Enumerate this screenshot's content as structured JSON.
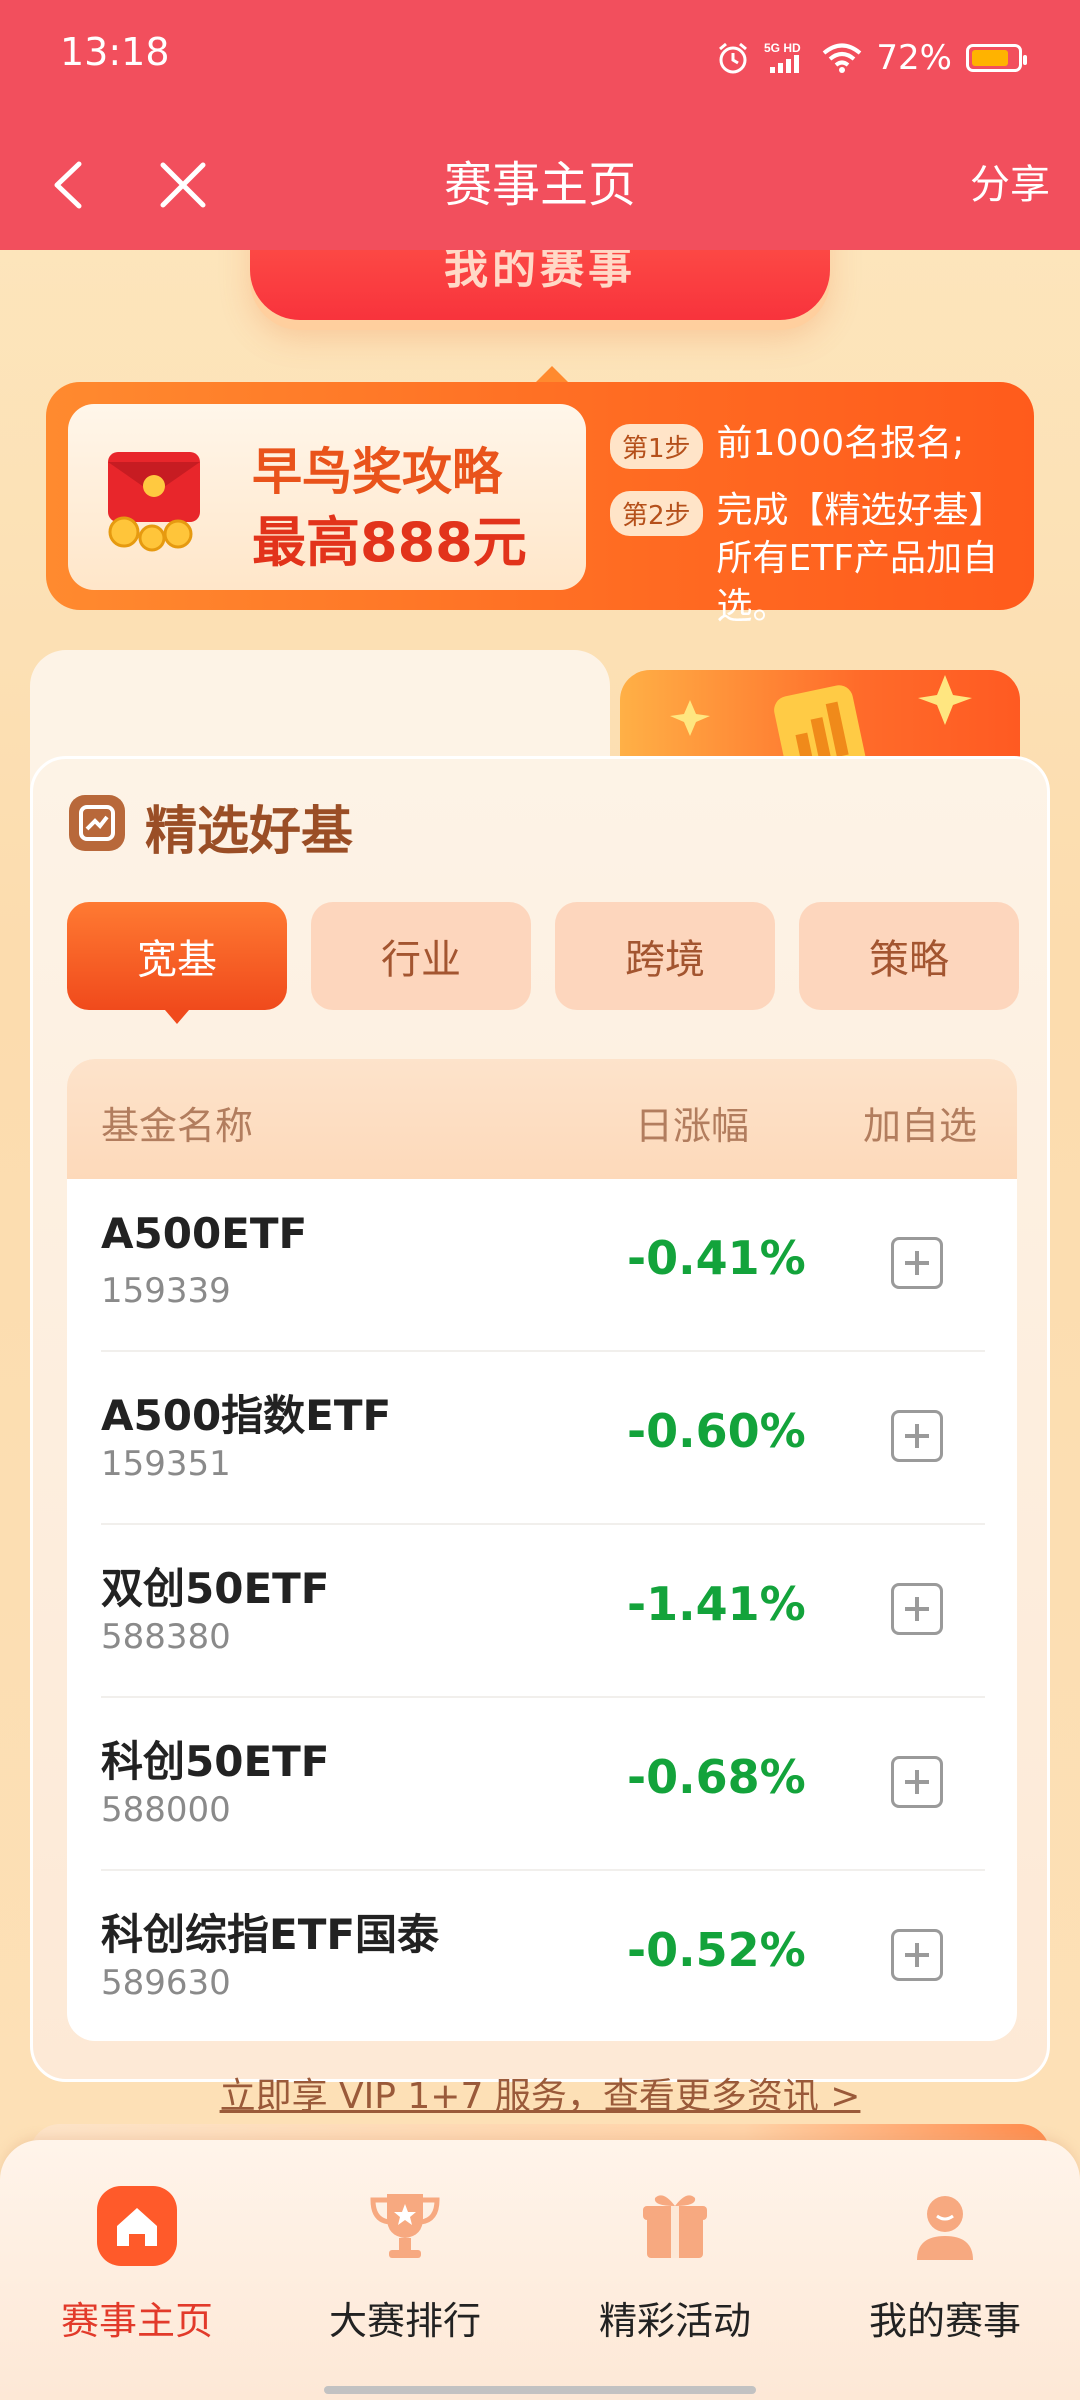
{
  "status": {
    "time": "13:18",
    "network": "5G HD",
    "battery": "72%"
  },
  "nav": {
    "title": "赛事主页",
    "share": "分享"
  },
  "top_pill": {
    "label": "我的赛事"
  },
  "early_bird": {
    "title": "早鸟奖攻略",
    "amount": "最高888元",
    "steps": [
      {
        "badge": "第1步",
        "text": "前1000名报名;"
      },
      {
        "badge": "第2步",
        "text": "完成【精选好基】所有ETF产品加自选。"
      }
    ]
  },
  "panel": {
    "title": "精选好基",
    "tabs": [
      "宽基",
      "行业",
      "跨境",
      "策略"
    ],
    "active_tab": "宽基",
    "table": {
      "headers": {
        "name": "基金名称",
        "change": "日涨幅",
        "add": "加自选"
      },
      "rows": [
        {
          "name": "A500ETF",
          "code": "159339",
          "change": "-0.41%"
        },
        {
          "name": "A500指数ETF",
          "code": "159351",
          "change": "-0.60%"
        },
        {
          "name": "双创50ETF",
          "code": "588380",
          "change": "-1.41%"
        },
        {
          "name": "科创50ETF",
          "code": "588000",
          "change": "-0.68%"
        },
        {
          "name": "科创综指ETF国泰",
          "code": "589630",
          "change": "-0.52%"
        }
      ]
    },
    "vip_link": "立即享 VIP 1+7 服务，查看更多资讯 >"
  },
  "bottom_nav": {
    "items": [
      {
        "label": "赛事主页",
        "icon": "home-icon",
        "active": true
      },
      {
        "label": "大赛排行",
        "icon": "trophy-icon",
        "active": false
      },
      {
        "label": "精彩活动",
        "icon": "gift-icon",
        "active": false
      },
      {
        "label": "我的赛事",
        "icon": "user-icon",
        "active": false
      }
    ]
  },
  "colors": {
    "header": "#f24f5d",
    "accent": "#f04a1c",
    "negative": "#13a33b",
    "active_nav": "#e23a2a"
  }
}
